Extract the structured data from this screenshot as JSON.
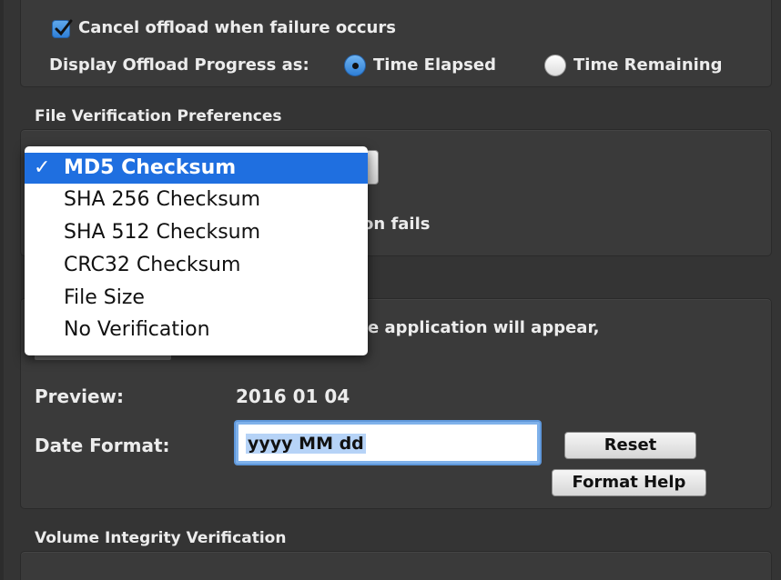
{
  "offload": {
    "cancel_on_failure_label": "Cancel offload when failure occurs",
    "cancel_on_failure_checked": true,
    "progress_display_label": "Display Offload Progress as:",
    "options": [
      {
        "label": "Time Elapsed",
        "selected": true
      },
      {
        "label": "Time Remaining",
        "selected": false
      }
    ]
  },
  "file_verification": {
    "title": "File Verification Preferences",
    "obscured_text_fragment": "on fails",
    "menu": {
      "selected_index": 0,
      "check_glyph": "✓",
      "items": [
        "MD5 Checksum",
        "SHA 256 Checksum",
        "SHA 512 Checksum",
        "CRC32 Checksum",
        "File Size",
        "No Verification"
      ]
    }
  },
  "date": {
    "description_fragment": "e application will appear,",
    "preview_label": "Preview:",
    "preview_value": "2016 01 04",
    "format_label": "Date Format:",
    "format_value": "yyyy MM dd",
    "reset_label": "Reset",
    "format_help_label": "Format Help"
  },
  "volume": {
    "title": "Volume Integrity Verification"
  },
  "colors": {
    "background": "#343434",
    "accent_blue": "#1f6fe0",
    "text": "#ececec"
  }
}
